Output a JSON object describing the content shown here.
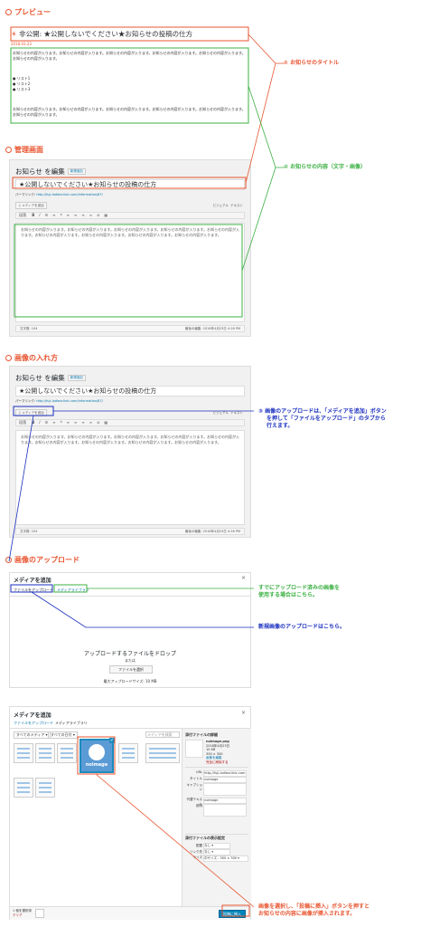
{
  "colors": {
    "orange": "#e8542f",
    "green": "#3cb043",
    "blue": "#1a2fbf",
    "wp_link": "#0073aa"
  },
  "sections": {
    "preview": "プレビュー",
    "admin": "管理画面",
    "image_insert": "画像の入れ方",
    "image_upload": "画像のアップロード"
  },
  "preview": {
    "private_prefix": "非公開:",
    "title": "★公開しないでください★お知らせの投稿の仕方",
    "date": "2018.03.23",
    "para1": "お知らせの内容が入ります。お知らせの内容が入ります。お知らせの内容が入ります。お知らせの内容が入ります。お知らせの内容が入ります。お知らせの内容が入ります。",
    "list": [
      "リスト1",
      "リスト2",
      "リスト3"
    ],
    "para2": "お知らせの内容が入ります。お知らせの内容が入ります。お知らせの内容が入ります。お知らせの内容が入ります。お知らせの内容が入ります。お知らせの内容が入ります。"
  },
  "admin": {
    "heading": "お知らせ を編集",
    "new_badge": "新規追加",
    "post_title": "★公開しないでください★お知らせの投稿の仕方",
    "permalink_label": "パーマリンク:",
    "permalink_url": "http://fuji-ladiesclinic.com/information/87/",
    "add_media": "メディアを追加",
    "tab_visual": "ビジュアル",
    "tab_text": "テキスト",
    "format_select": "段落",
    "editor_text": "お知らせの内容が入ります。お知らせの内容が入ります。お知らせの内容が入ります。お知らせの内容が入ります。お知らせの内容が入ります。お知らせの内容が入ります。お知らせの内容が入ります。お知らせの内容が入ります。お知らせの内容が入ります。",
    "word_count": "文字数: 104",
    "last_edited": "最後の編集: 2018年4月23日 4:16 PM"
  },
  "annotations": {
    "title_note": "① お知らせのタイトル",
    "content_note": "② お知らせの内容（文字・画像）",
    "media_note_1": "③ 画像のアップロードは、「メディアを追加」ボタン",
    "media_note_2": "を押して「ファイルをアップロード」のタブから",
    "media_note_3": "行えます。",
    "library_note_1": "すでにアップロード済みの画像を",
    "library_note_2": "使用する場合はこちら。",
    "upload_note": "新規画像のアップロードはこちら。",
    "insert_note_1": "画像を選択し、「投稿に挿入」ボタンを押すと",
    "insert_note_2": "お知らせの内容に画像が挿入されます。"
  },
  "media_modal": {
    "title": "メディアを追加",
    "tab_upload": "ファイルをアップロード",
    "tab_library": "メディアライブラリ",
    "drop_text": "アップロードするファイルをドロップ",
    "or_text": "または",
    "select_button": "ファイルを選択",
    "max_size": "最大アップロードサイズ: 10 MB",
    "close": "×"
  },
  "media_library": {
    "title": "メディアを追加",
    "tab_upload": "ファイルをアップロード",
    "tab_library": "メディアライブラリ",
    "filter_all": "すべてのメディア",
    "filter_date": "すべての日付",
    "search_placeholder": "メディアを検索",
    "selected_logo": "noimage",
    "details_heading": "添付ファイルの詳細",
    "file_name": "noimage.png",
    "file_date": "2018年4月23日",
    "file_size": "10 KB",
    "file_dims": "300 × 300",
    "edit_link": "画像を編集",
    "delete_link": "完全に削除する",
    "url_label": "URL",
    "url_value": "http://fuji-ladiesclinic.com",
    "title_label": "タイトル",
    "title_value": "noimage",
    "caption_label": "キャプション",
    "alt_label": "代替テキスト",
    "alt_value": "noimage",
    "desc_label": "説明",
    "display_heading": "添付ファイルの表示設定",
    "align_label": "配置",
    "align_value": "なし",
    "link_label": "リンク先",
    "link_value": "なし",
    "size_label": "サイズ",
    "size_value": "中サイズ - 300 × 300",
    "selected_count": "1 個を選択済",
    "clear_link": "クリア",
    "insert_button": "投稿に挿入",
    "close": "×"
  }
}
